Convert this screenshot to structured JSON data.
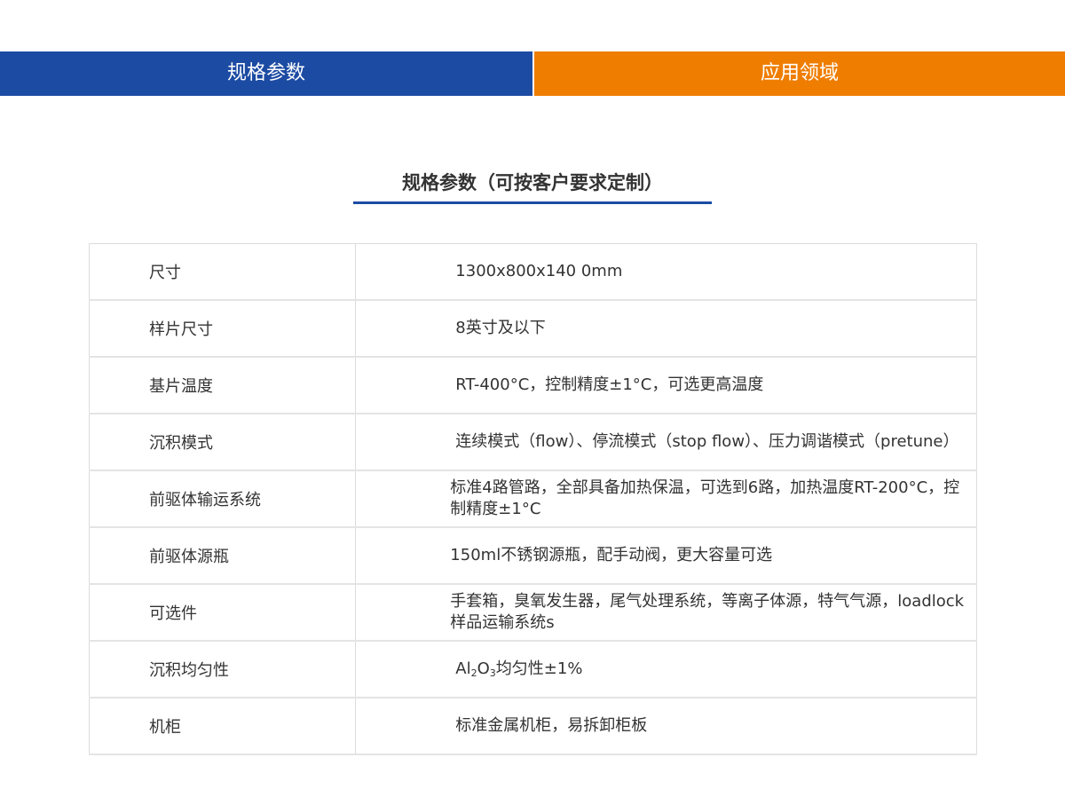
{
  "tabs": {
    "specs": "规格参数",
    "applications": "应用领域"
  },
  "section_title": "规格参数（可按客户要求定制）",
  "table": {
    "rows": [
      {
        "label": "尺寸",
        "value": "1300x800x140 0mm"
      },
      {
        "label": "样片尺寸",
        "value": "8英寸及以下"
      },
      {
        "label": "基片温度",
        "value": "RT-400°C，控制精度±1°C，可选更高温度"
      },
      {
        "label": "沉积模式",
        "value": "连续模式（flow）、停流模式（stop flow）、压力调谐模式（pretune）"
      },
      {
        "label": "前驱体输运系统",
        "value": "标准4路管路，全部具备加热保温，可选到6路，加热温度RT-200°C，控制精度±1°C"
      },
      {
        "label": "前驱体源瓶",
        "value": "150ml不锈钢源瓶，配手动阀，更大容量可选"
      },
      {
        "label": "可选件",
        "value": "手套箱，臭氧发生器，尾气处理系统，等离子体源，特气气源，loadlock 样品运输系统s"
      },
      {
        "label": "沉积均匀性",
        "value_parts": {
          "pre": "Al",
          "sub1": "2",
          "mid": "O",
          "sub2": "3",
          "post": "均匀性±1%"
        }
      },
      {
        "label": "机柜",
        "value": "标准金属机柜，易拆卸柜板"
      }
    ]
  },
  "colors": {
    "tab_blue": "#1c4ba3",
    "tab_orange": "#ef7d00",
    "text": "#333333",
    "border": "#dcdcdc"
  }
}
